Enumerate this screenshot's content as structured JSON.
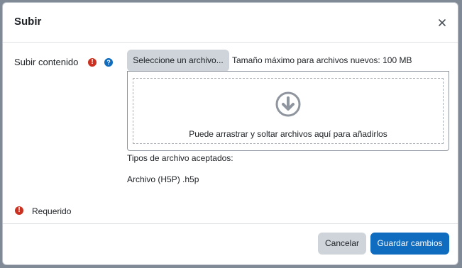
{
  "dialog": {
    "title": "Subir",
    "close_icon": "close-icon"
  },
  "field": {
    "label": "Subir contenido",
    "required_icon": "!",
    "help_icon": "?"
  },
  "filepicker": {
    "choose_button": "Seleccione un archivo...",
    "max_size": "Tamaño máximo para archivos nuevos: 100 MB",
    "drop_text": "Puede arrastrar y soltar archivos aquí para añadirlos",
    "drop_icon": "arrow-circle-down-icon"
  },
  "accepted": {
    "label": "Tipos de archivo aceptados:",
    "types": [
      "Archivo (H5P) .h5p"
    ]
  },
  "required_note": {
    "icon": "!",
    "text": "Requerido"
  },
  "footer": {
    "cancel_label": "Cancelar",
    "save_label": "Guardar cambios"
  },
  "colors": {
    "primary": "#0f6cbf",
    "required": "#ca3120",
    "secondary_button": "#ced4da"
  }
}
